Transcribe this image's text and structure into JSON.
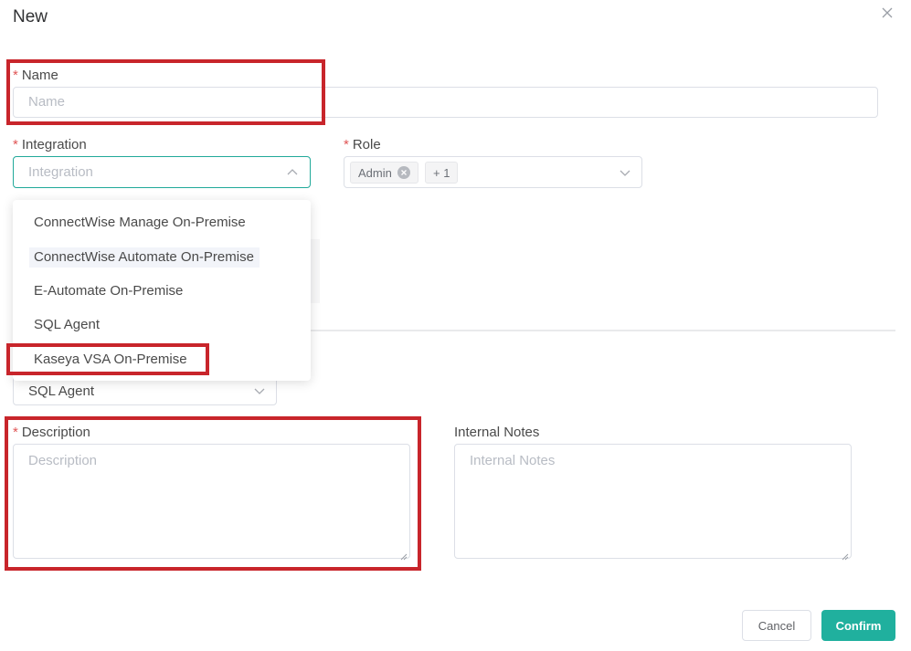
{
  "dialog": {
    "title": "New"
  },
  "fields": {
    "name": {
      "required_mark": "*",
      "label": "Name",
      "placeholder": "Name"
    },
    "integration": {
      "required_mark": "*",
      "label": "Integration",
      "placeholder": "Integration"
    },
    "role": {
      "required_mark": "*",
      "label": "Role",
      "tags": [
        "Admin",
        "+ 1"
      ]
    },
    "sql_select": {
      "value": "SQL Agent"
    },
    "description": {
      "required_mark": "*",
      "label": "Description",
      "placeholder": "Description"
    },
    "internal_notes": {
      "label": "Internal Notes",
      "placeholder": "Internal Notes"
    }
  },
  "integration_options": [
    "ConnectWise Manage On-Premise",
    "ConnectWise Automate On-Premise",
    "E-Automate On-Premise",
    "SQL Agent",
    "Kaseya VSA On-Premise"
  ],
  "footer": {
    "cancel_label": "Cancel",
    "confirm_label": "Confirm"
  },
  "colors": {
    "accent": "#20b09e",
    "highlight": "#c8252b",
    "required": "#e05555"
  }
}
